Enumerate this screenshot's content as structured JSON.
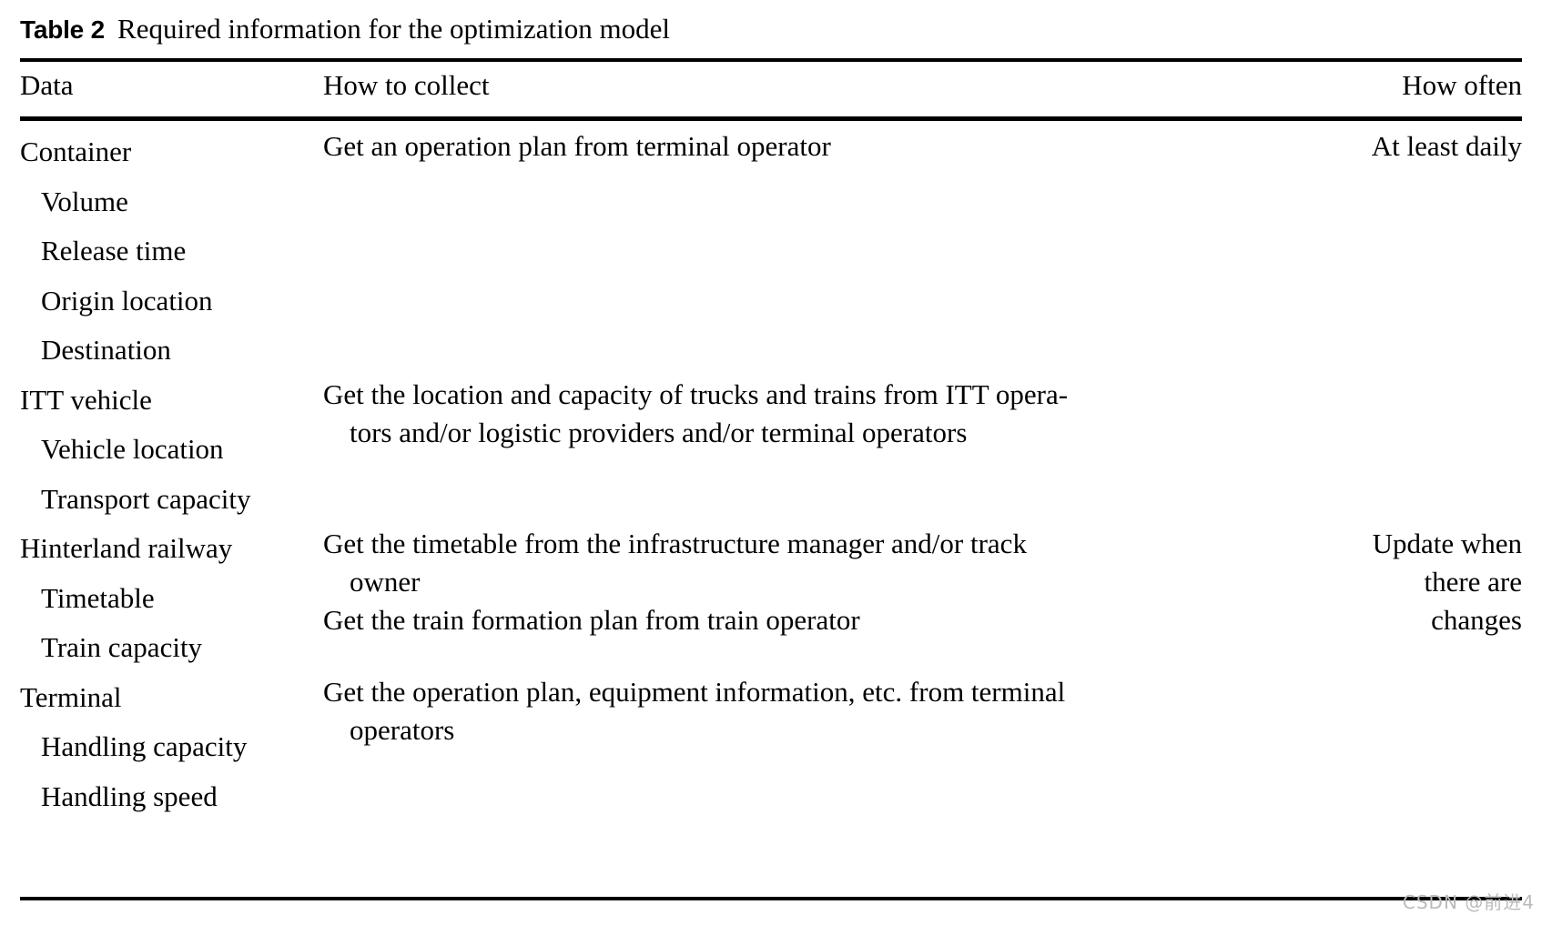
{
  "caption": {
    "label": "Table 2",
    "text": "Required information for the optimization model"
  },
  "columns": {
    "data": "Data",
    "how_to_collect": "How to collect",
    "how_often": "How often"
  },
  "data_column_lines": [
    "Container",
    "Volume",
    "Release time",
    "Origin location",
    "Destination",
    "ITT vehicle",
    "Vehicle location",
    "Transport capacity",
    "Hinterland railway",
    "Timetable",
    "Train capacity",
    "Terminal",
    "Handling capacity",
    "Handling speed"
  ],
  "how_to_collect_blocks": {
    "container_line1": "Get an operation plan from terminal operator",
    "itt_line1": "Get the location and capacity of trucks and trains from ITT opera-",
    "itt_line2": "tors and/or logistic providers and/or terminal operators",
    "railway_a_line1": "Get the timetable from the infrastructure manager and/or track",
    "railway_a_line2": "owner",
    "railway_b_line1": "Get the train formation plan from train operator",
    "terminal_line1": "Get the operation plan, equipment information, etc. from terminal",
    "terminal_line2": "operators"
  },
  "how_often_blocks": {
    "container": "At least daily",
    "railway_line1": "Update when",
    "railway_line2": "there are",
    "railway_line3": "changes"
  },
  "watermark": "CSDN @前进4",
  "colors": {
    "rule": "#000000",
    "text": "#000000",
    "background": "#ffffff",
    "watermark": "#bbbbbb"
  }
}
